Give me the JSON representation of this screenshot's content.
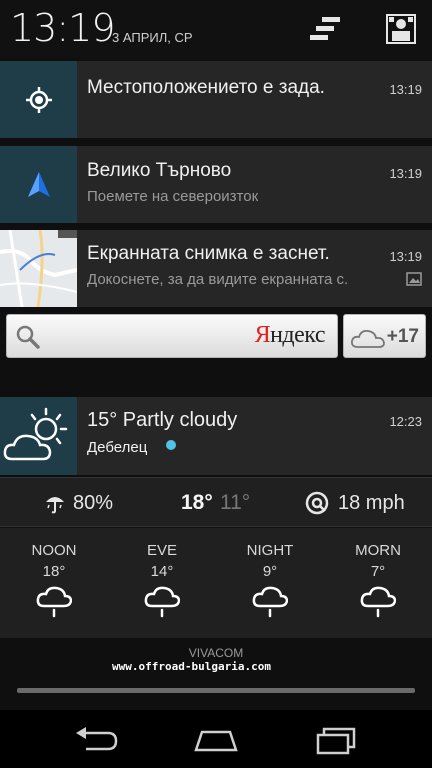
{
  "status": {
    "clock": "13:19",
    "date": "3 АПРИЛ, СР"
  },
  "notifications": [
    {
      "title": "Местоположението е зада.",
      "subtitle": "",
      "time": "13:19",
      "icon": "location-target-icon"
    },
    {
      "title": "Велико Търново",
      "subtitle": "Поемете на североизток",
      "time": "13:19",
      "icon": "navigation-arrow-icon"
    },
    {
      "title": "Екранната снимка е заснет.",
      "subtitle": "Докоснете, за да видите екранната с.",
      "time": "13:19",
      "icon": "screenshot-thumbnail"
    }
  ],
  "search": {
    "logo_first": "Я",
    "logo_rest": "ндекс",
    "weather_temp": "+17"
  },
  "weather": {
    "title": "15° Partly cloudy",
    "location": "Дебелец",
    "time": "12:23",
    "precip": "80%",
    "high": "18°",
    "low": "11°",
    "wind": "18 mph",
    "forecast": [
      {
        "label": "NOON",
        "temp": "18°"
      },
      {
        "label": "EVE",
        "temp": "14°"
      },
      {
        "label": "NIGHT",
        "temp": "9°"
      },
      {
        "label": "MORN",
        "temp": "7°"
      }
    ]
  },
  "carrier": "VIVACOM",
  "watermark": "www.offroad-bulgaria.com",
  "colors": {
    "notif_bg": "#262626",
    "icon_bg": "#1f3c49",
    "yandex_red": "#e0201c",
    "location_dot": "#4fc3e8"
  }
}
